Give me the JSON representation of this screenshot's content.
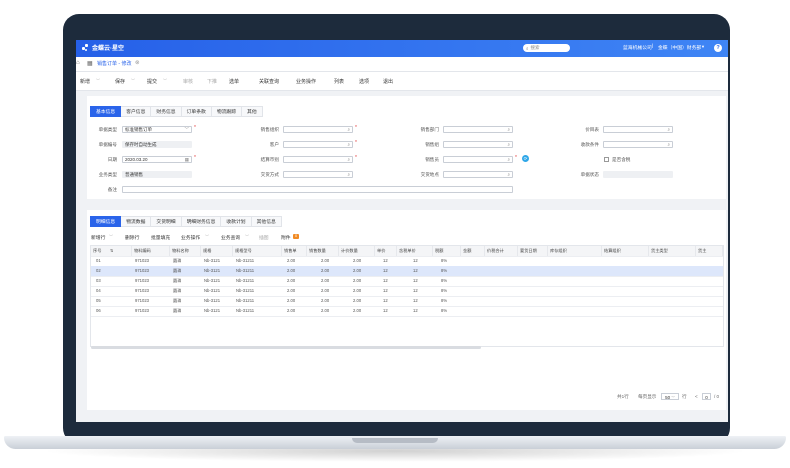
{
  "app": {
    "logo_text": "金蝶云·星空",
    "search_placeholder": "搜索",
    "company": "蓝海机械公司",
    "org": "金蝶（中国）财务部",
    "help": "?"
  },
  "tabs": {
    "active": "销售订单 - 修改"
  },
  "toolbar": {
    "items": [
      "新增",
      "保存",
      "提交",
      "审核",
      "下推",
      "选单",
      "关联查询",
      "业务操作",
      "列表",
      "选项",
      "退出"
    ]
  },
  "header_tabs": [
    "基本信息",
    "客户信息",
    "财务信息",
    "订单条款",
    "物流跟踪",
    "其他"
  ],
  "form": {
    "doc_type_label": "单据类型",
    "doc_type_value": "标准销售订单",
    "doc_no_label": "单据编号",
    "doc_no_value": "保存时自动生成",
    "date_label": "日期",
    "date_value": "2020.03.20",
    "biz_type_label": "业务类型",
    "biz_type_value": "普通销售",
    "remark_label": "备注",
    "sale_org_label": "销售组织",
    "customer_label": "客户",
    "settle_currency_label": "结算币别",
    "delivery_mode_label": "交货方式",
    "sale_dept_label": "销售部门",
    "sale_group_label": "销售组",
    "salesman_label": "销售员",
    "delivery_place_label": "交货地点",
    "price_list_label": "价目表",
    "collect_term_label": "收款条件",
    "tax_incl_label": "是否含税",
    "doc_status_label": "单据状态"
  },
  "detail_tabs": [
    "明细信息",
    "物流数据",
    "交货明细",
    "明细财务信息",
    "收款计划",
    "其他信息"
  ],
  "grid_toolbar": {
    "items": [
      "新增行",
      "删除行",
      "批量填充",
      "业务操作",
      "业务查询",
      "插图",
      "附件"
    ],
    "badge": "0"
  },
  "table": {
    "columns": [
      "序号",
      "物料编码",
      "物料名称",
      "规格",
      "规格型号",
      "销售单",
      "销售数量",
      "计价数量",
      "单价",
      "含税单价",
      "税额",
      "金额",
      "价税合计",
      "要货日期",
      "库存组织",
      "结算组织",
      "货主类型",
      "货主"
    ],
    "rows": [
      [
        "01",
        "971023",
        "圆珠",
        "Nb-3121",
        "Nb-31211",
        "2.00",
        "2.00",
        "2.00",
        "12",
        "12",
        "8%"
      ],
      [
        "02",
        "971023",
        "圆珠",
        "Nb-3121",
        "Nb-31211",
        "2.00",
        "2.00",
        "2.00",
        "12",
        "12",
        "8%"
      ],
      [
        "03",
        "971023",
        "圆珠",
        "Nb-3121",
        "Nb-31211",
        "2.00",
        "2.00",
        "2.00",
        "12",
        "12",
        "8%"
      ],
      [
        "04",
        "971023",
        "圆珠",
        "Nb-3121",
        "Nb-31211",
        "2.00",
        "2.00",
        "2.00",
        "12",
        "12",
        "8%"
      ],
      [
        "05",
        "971023",
        "圆珠",
        "Nb-3121",
        "Nb-31211",
        "2.00",
        "2.00",
        "2.00",
        "12",
        "12",
        "8%"
      ],
      [
        "06",
        "971023",
        "圆珠",
        "Nb-3121",
        "Nb-31211",
        "2.00",
        "2.00",
        "2.00",
        "12",
        "12",
        "8%"
      ]
    ]
  },
  "pager": {
    "total_label": "共1行",
    "page_size_label": "每页显示",
    "page_size": "50",
    "unit": "行",
    "page": "0",
    "of_total": "/ 0"
  },
  "colors": {
    "brand": "#2a64ea",
    "bezel": "#1d2b3c"
  }
}
